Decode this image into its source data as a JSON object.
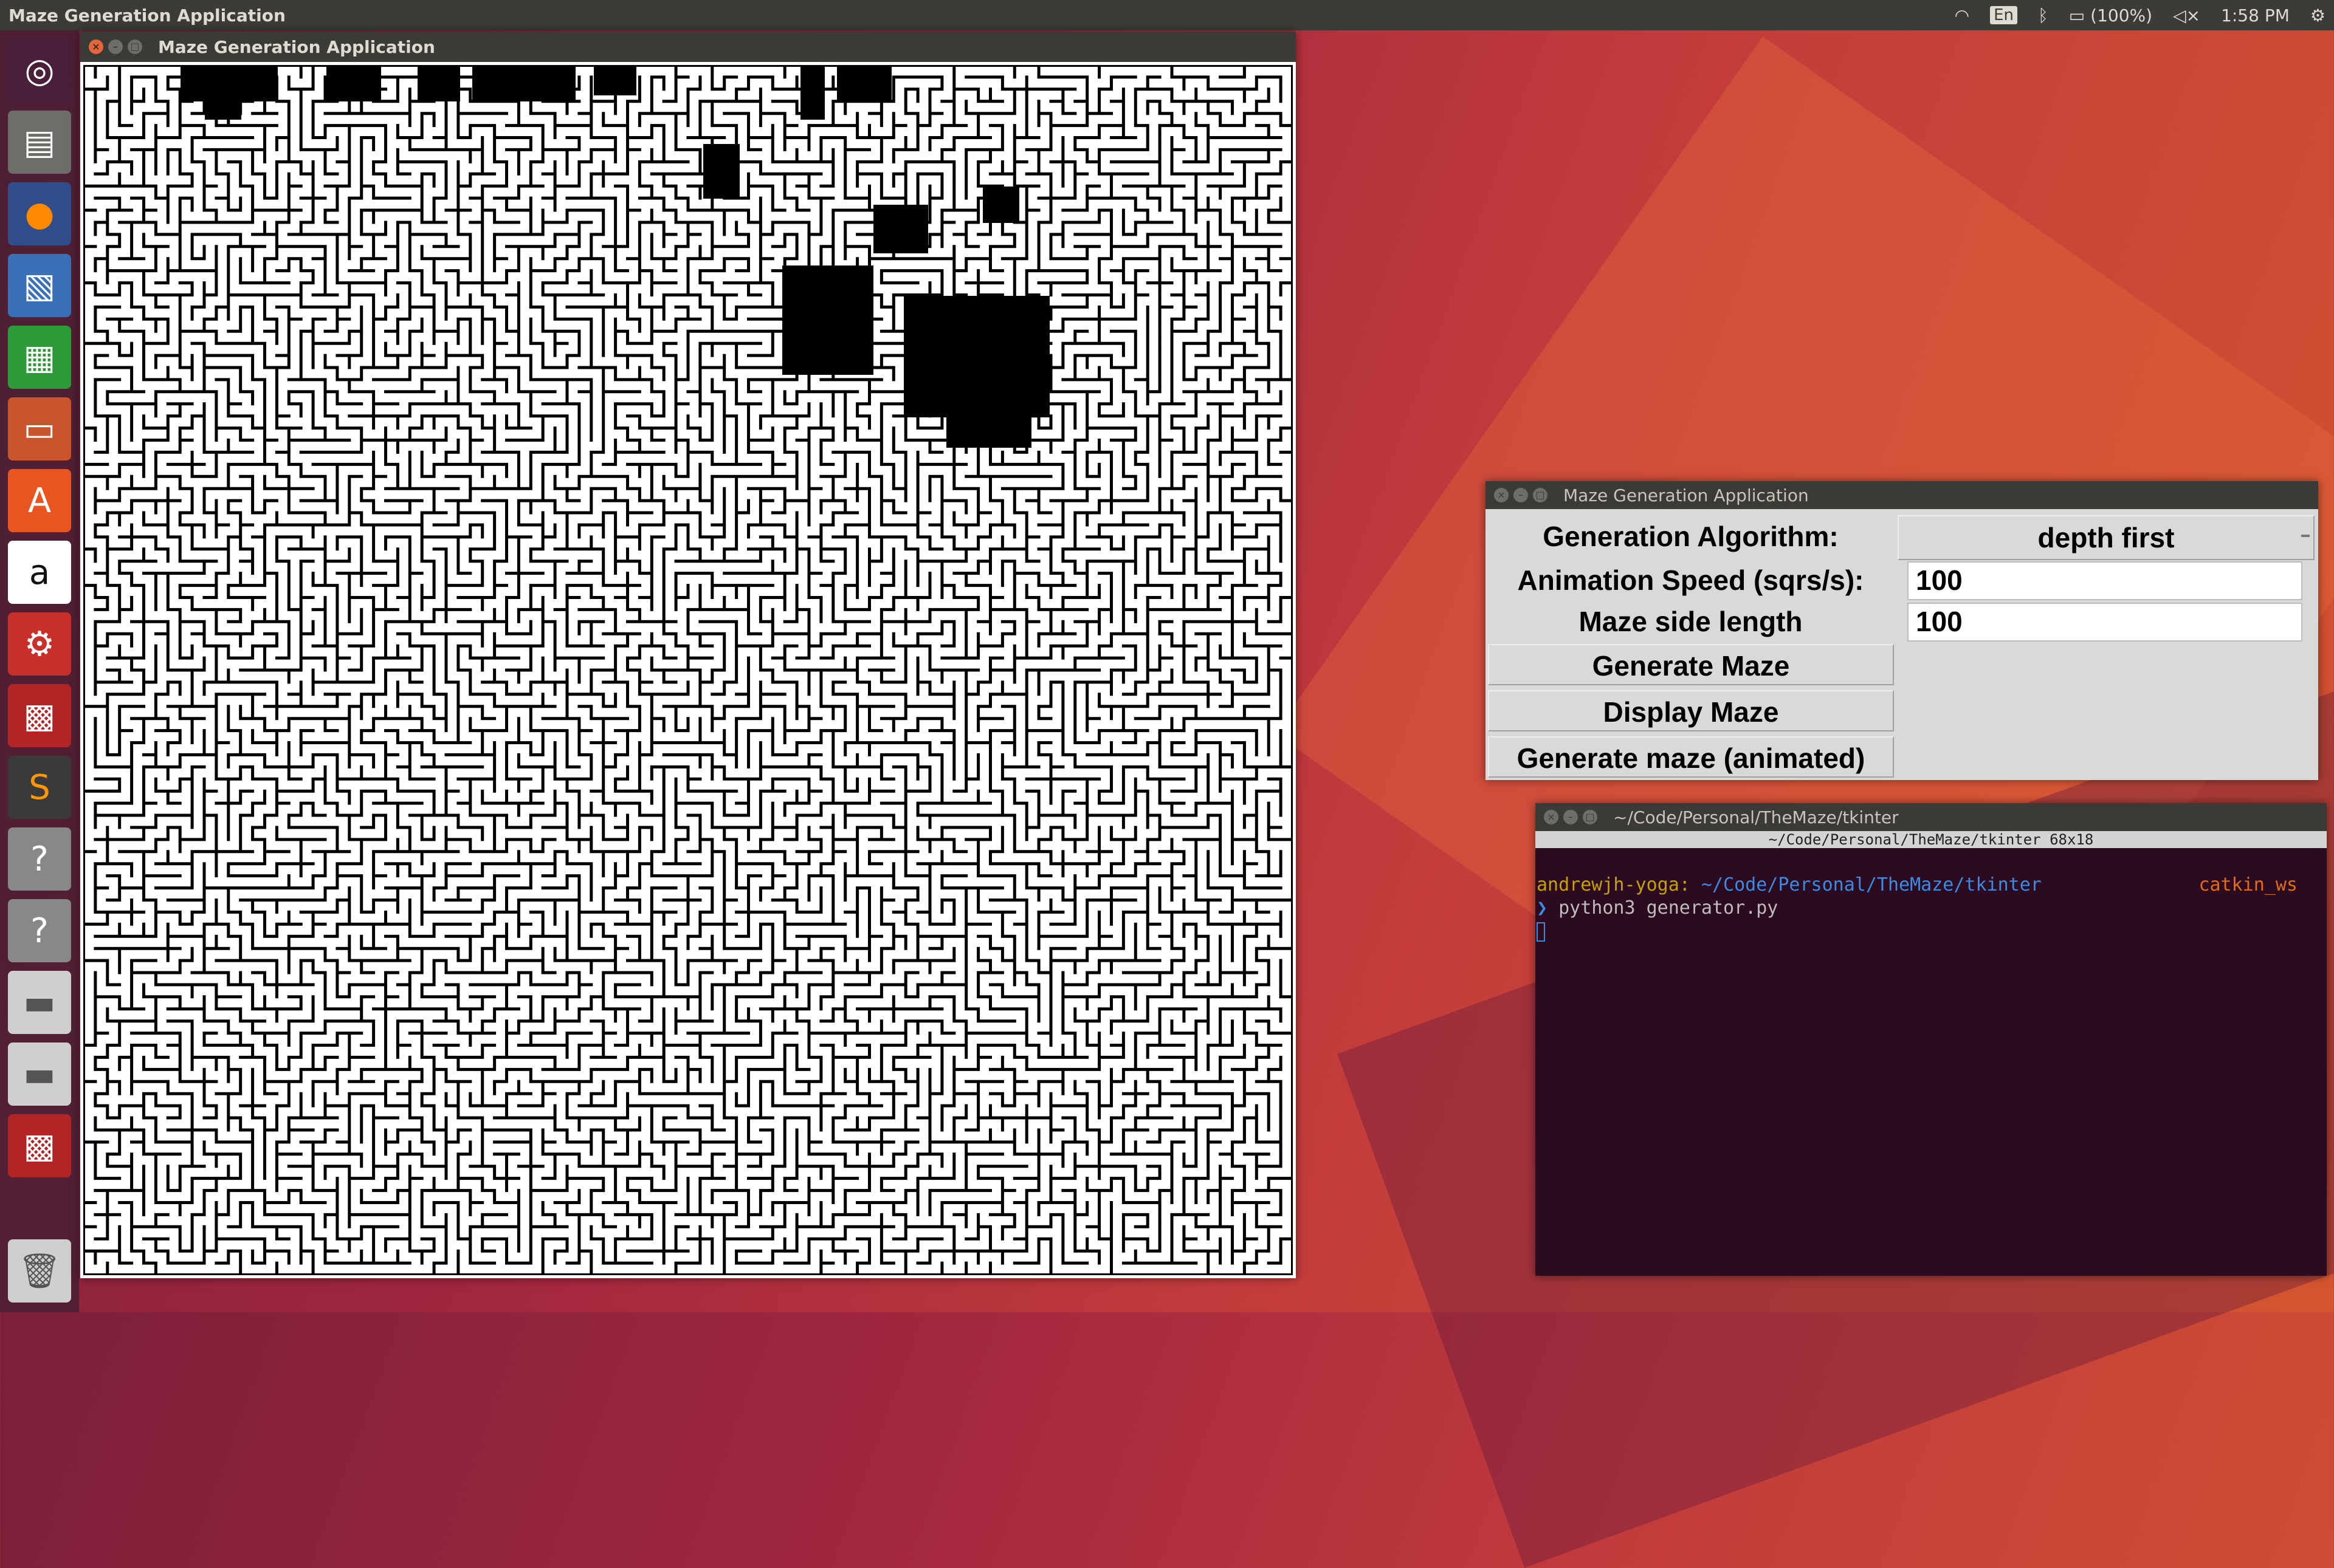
{
  "top_panel": {
    "app_title": "Maze Generation Application",
    "keyboard_layout": "En",
    "battery": "(100%)",
    "clock": "1:58 PM",
    "icons": [
      "wifi-icon",
      "keyboard-icon",
      "bluetooth-icon",
      "battery-icon",
      "volume-muted-icon",
      "gear-icon"
    ]
  },
  "launcher": {
    "items": [
      "ubuntu-dash-icon",
      "files-icon",
      "firefox-icon",
      "image-viewer-icon",
      "spreadsheet-icon",
      "presentation-icon",
      "software-center-icon",
      "amazon-icon",
      "system-settings-icon",
      "app-icon",
      "sublime-text-icon",
      "unknown-app-icon",
      "unknown-app-icon",
      "drive-icon",
      "drive-icon",
      "app-icon",
      "trash-icon"
    ],
    "colors": {
      "dash": "#2c001e",
      "files": "#6e6d69",
      "firefox": "#e66000",
      "image": "#3b6fb6",
      "calc": "#2e9b3b",
      "impress": "#c9552c",
      "software": "#e95420",
      "amazon": "#ffffff",
      "settings": "#c9302c",
      "red": "#b32424",
      "sublime": "#ff9800",
      "unknown": "#888888",
      "drive": "#cfcfcf",
      "trash": "#cfcfcf"
    }
  },
  "maze_window": {
    "title": "Maze Generation Application"
  },
  "control_window": {
    "title": "Maze Generation Application",
    "algorithm_label": "Generation Algorithm:",
    "algorithm_value": "depth first",
    "speed_label": "Animation Speed (sqrs/s):",
    "speed_value": "100",
    "side_label": "Maze side length",
    "side_value": "100",
    "generate_button": "Generate Maze",
    "display_button": "Display Maze",
    "animated_button": "Generate maze (animated)"
  },
  "terminal": {
    "title": "~/Code/Personal/TheMaze/tkinter",
    "header": "~/Code/Personal/TheMaze/tkinter 68x18",
    "user": "andrewjh-yoga:",
    "path": " ~/Code/Personal/TheMaze/tkinter",
    "workspace": "catkin_ws",
    "prompt": "❯",
    "command": " python3 generator.py"
  }
}
